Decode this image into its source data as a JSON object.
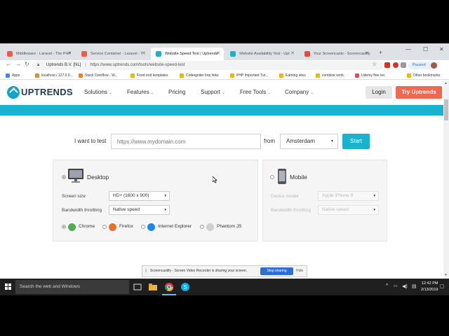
{
  "browser": {
    "tabs": [
      {
        "title": "Middleware - Laravel - The PHP",
        "fav": "#f25a48"
      },
      {
        "title": "Service Container - Laravel - T",
        "fav": "#f25a48"
      },
      {
        "title": "Website Speed Test | Uptrends",
        "fav": "#19b3d0"
      },
      {
        "title": "Website Availability Test - Upt",
        "fav": "#19b3d0"
      },
      {
        "title": "Your Screencasts - Screencastify",
        "fav": "#e64a3b"
      }
    ],
    "new_tab": "+",
    "site_identity": "Uptrends B.V. [NL]",
    "url": "https://www.uptrends.com/tools/website-speed-test",
    "profile_status": "Paused",
    "bookmarks": [
      {
        "label": "Apps",
        "color": "#4285f4"
      },
      {
        "label": "localhost / 127.0.0...",
        "color": "#e38b2c"
      },
      {
        "label": "Stack Overflow - W...",
        "color": "#f48024"
      },
      {
        "label": "Front end templates",
        "color": "#f4b400"
      },
      {
        "label": "Codeigniter Imp links",
        "color": "#f4b400"
      },
      {
        "label": "PHP Important Tut...",
        "color": "#f4b400"
      },
      {
        "label": "Earning sites",
        "color": "#f4b400"
      },
      {
        "label": "combine work",
        "color": "#f4b400"
      },
      {
        "label": "Udemy free lec",
        "color": "#e34d4d"
      },
      {
        "label": "Other bookmarks",
        "color": "#f4b400"
      }
    ]
  },
  "site": {
    "logo_text": "UPTRENDS",
    "nav": [
      {
        "label": "Solutions",
        "caret": "⌄"
      },
      {
        "label": "Features",
        "caret": "⌄"
      },
      {
        "label": "Pricing",
        "caret": ""
      },
      {
        "label": "Support",
        "caret": "⌄"
      },
      {
        "label": "Free Tools",
        "caret": "⌄"
      },
      {
        "label": "Company",
        "caret": "⌄"
      }
    ],
    "login": "Login",
    "try": "Try Uptrends",
    "accent": "#19b3d0",
    "cta_color": "#f2674d"
  },
  "form": {
    "test_label": "I want to test",
    "url_placeholder": "https://www.mydomain.com",
    "from_label": "from",
    "location": "Amsterdam",
    "start": "Start"
  },
  "desktop": {
    "title": "Desktop",
    "screen_size_label": "Screen size",
    "screen_size": "HD+ (1600 x 900)",
    "bandwidth_label": "Bandwidth throttling",
    "bandwidth": "Native speed",
    "browsers": [
      {
        "label": "Chrome",
        "selected": true,
        "color": "#4caf50"
      },
      {
        "label": "Firefox",
        "selected": false,
        "color": "#e8702a"
      },
      {
        "label": "Internet Explorer",
        "selected": false,
        "color": "#1e88e5"
      },
      {
        "label": "Phantom JS",
        "selected": false,
        "color": "#cfcfcf"
      }
    ]
  },
  "mobile": {
    "title": "Mobile",
    "device_label": "Device model",
    "device": "Apple iPhone 8",
    "bandwidth_label": "Bandwidth throttling",
    "bandwidth": "Native speed"
  },
  "share_banner": {
    "text": "Screencastify - Screen Video Recorder is sharing your screen.",
    "stop": "Stop sharing",
    "hide": "Hide"
  },
  "taskbar": {
    "search": "Search the web and Windows",
    "time": "12:42 PM",
    "date": "2/13/2019"
  }
}
